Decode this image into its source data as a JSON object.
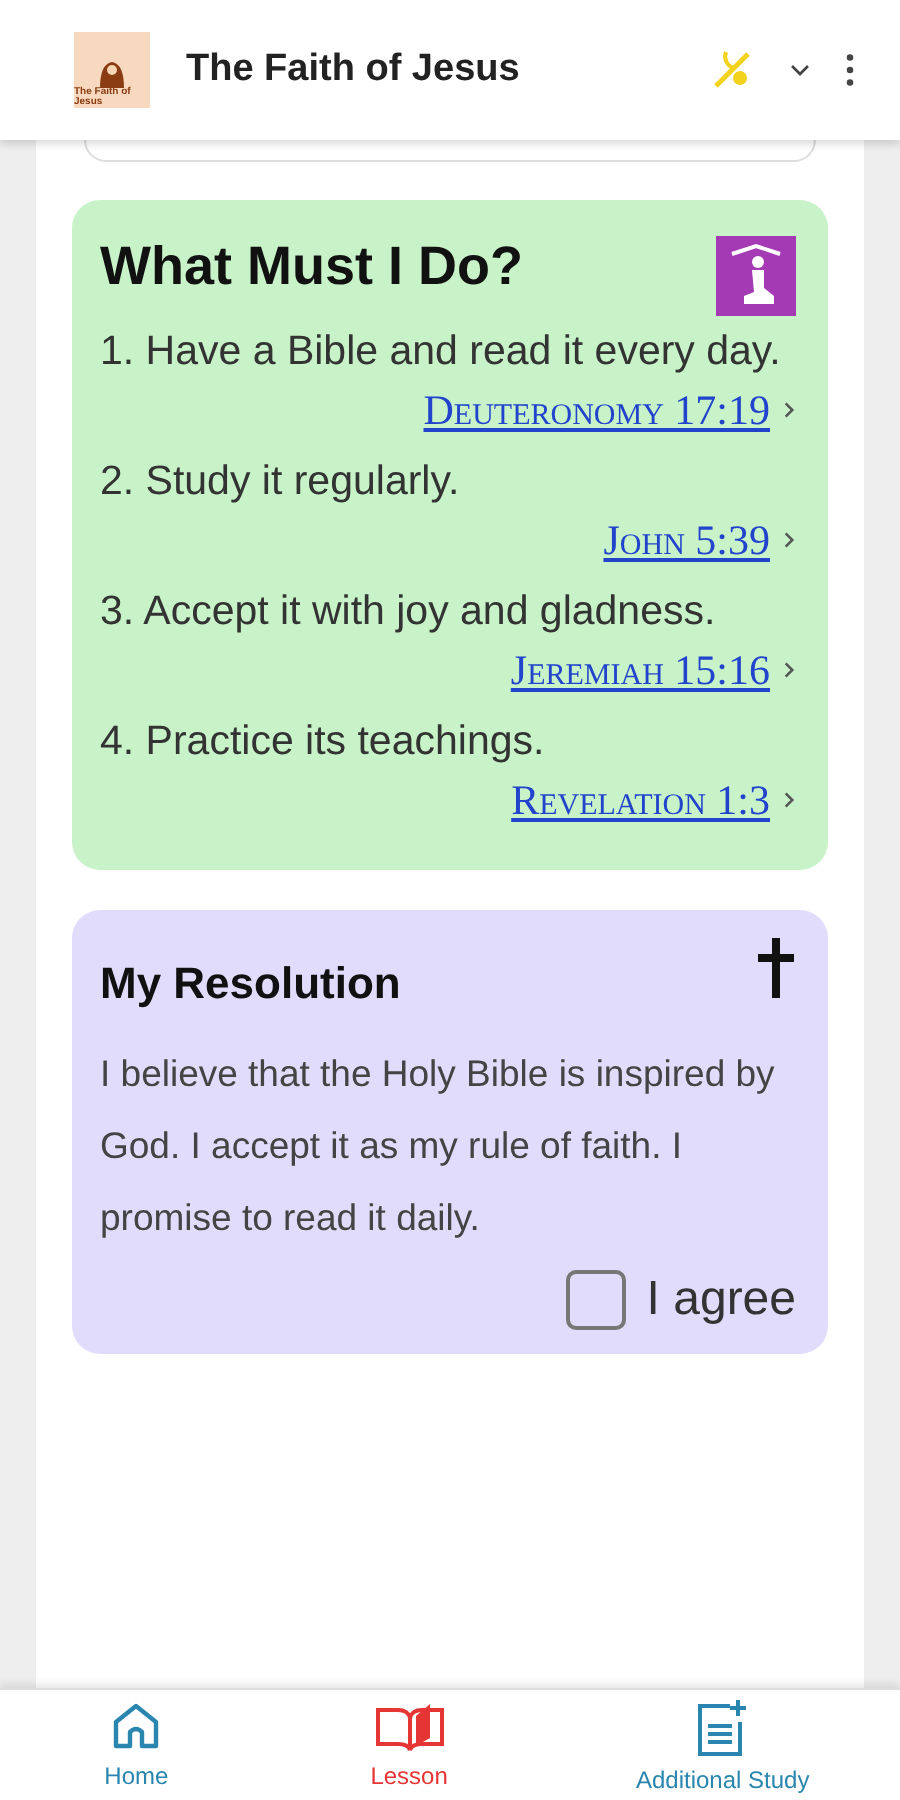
{
  "app_bar": {
    "title": "The Faith of Jesus",
    "logo_text": "The Faith of Jesus"
  },
  "steps_card": {
    "title": "What Must I Do?",
    "items": [
      {
        "text": "1. Have a Bible and read it every day.",
        "reference": "Deuteronomy 17:19"
      },
      {
        "text": "2. Study it regularly.",
        "reference": "John 5:39"
      },
      {
        "text": "3. Accept it with joy and gladness.",
        "reference": "Jeremiah 15:16"
      },
      {
        "text": "4. Practice its teachings.",
        "reference": "Revelation 1:3"
      }
    ]
  },
  "resolution_card": {
    "title": "My Resolution",
    "text": "I believe that the Holy Bible is inspired by God. I accept it as my rule of faith. I promise to read it daily.",
    "agree": {
      "label": "I agree",
      "checked": false
    }
  },
  "bottom_nav": [
    {
      "kind": "home",
      "label": "Home",
      "selected": false
    },
    {
      "kind": "lesson",
      "label": "Lesson",
      "selected": true
    },
    {
      "kind": "study",
      "label": "Additional Study",
      "selected": false
    }
  ]
}
